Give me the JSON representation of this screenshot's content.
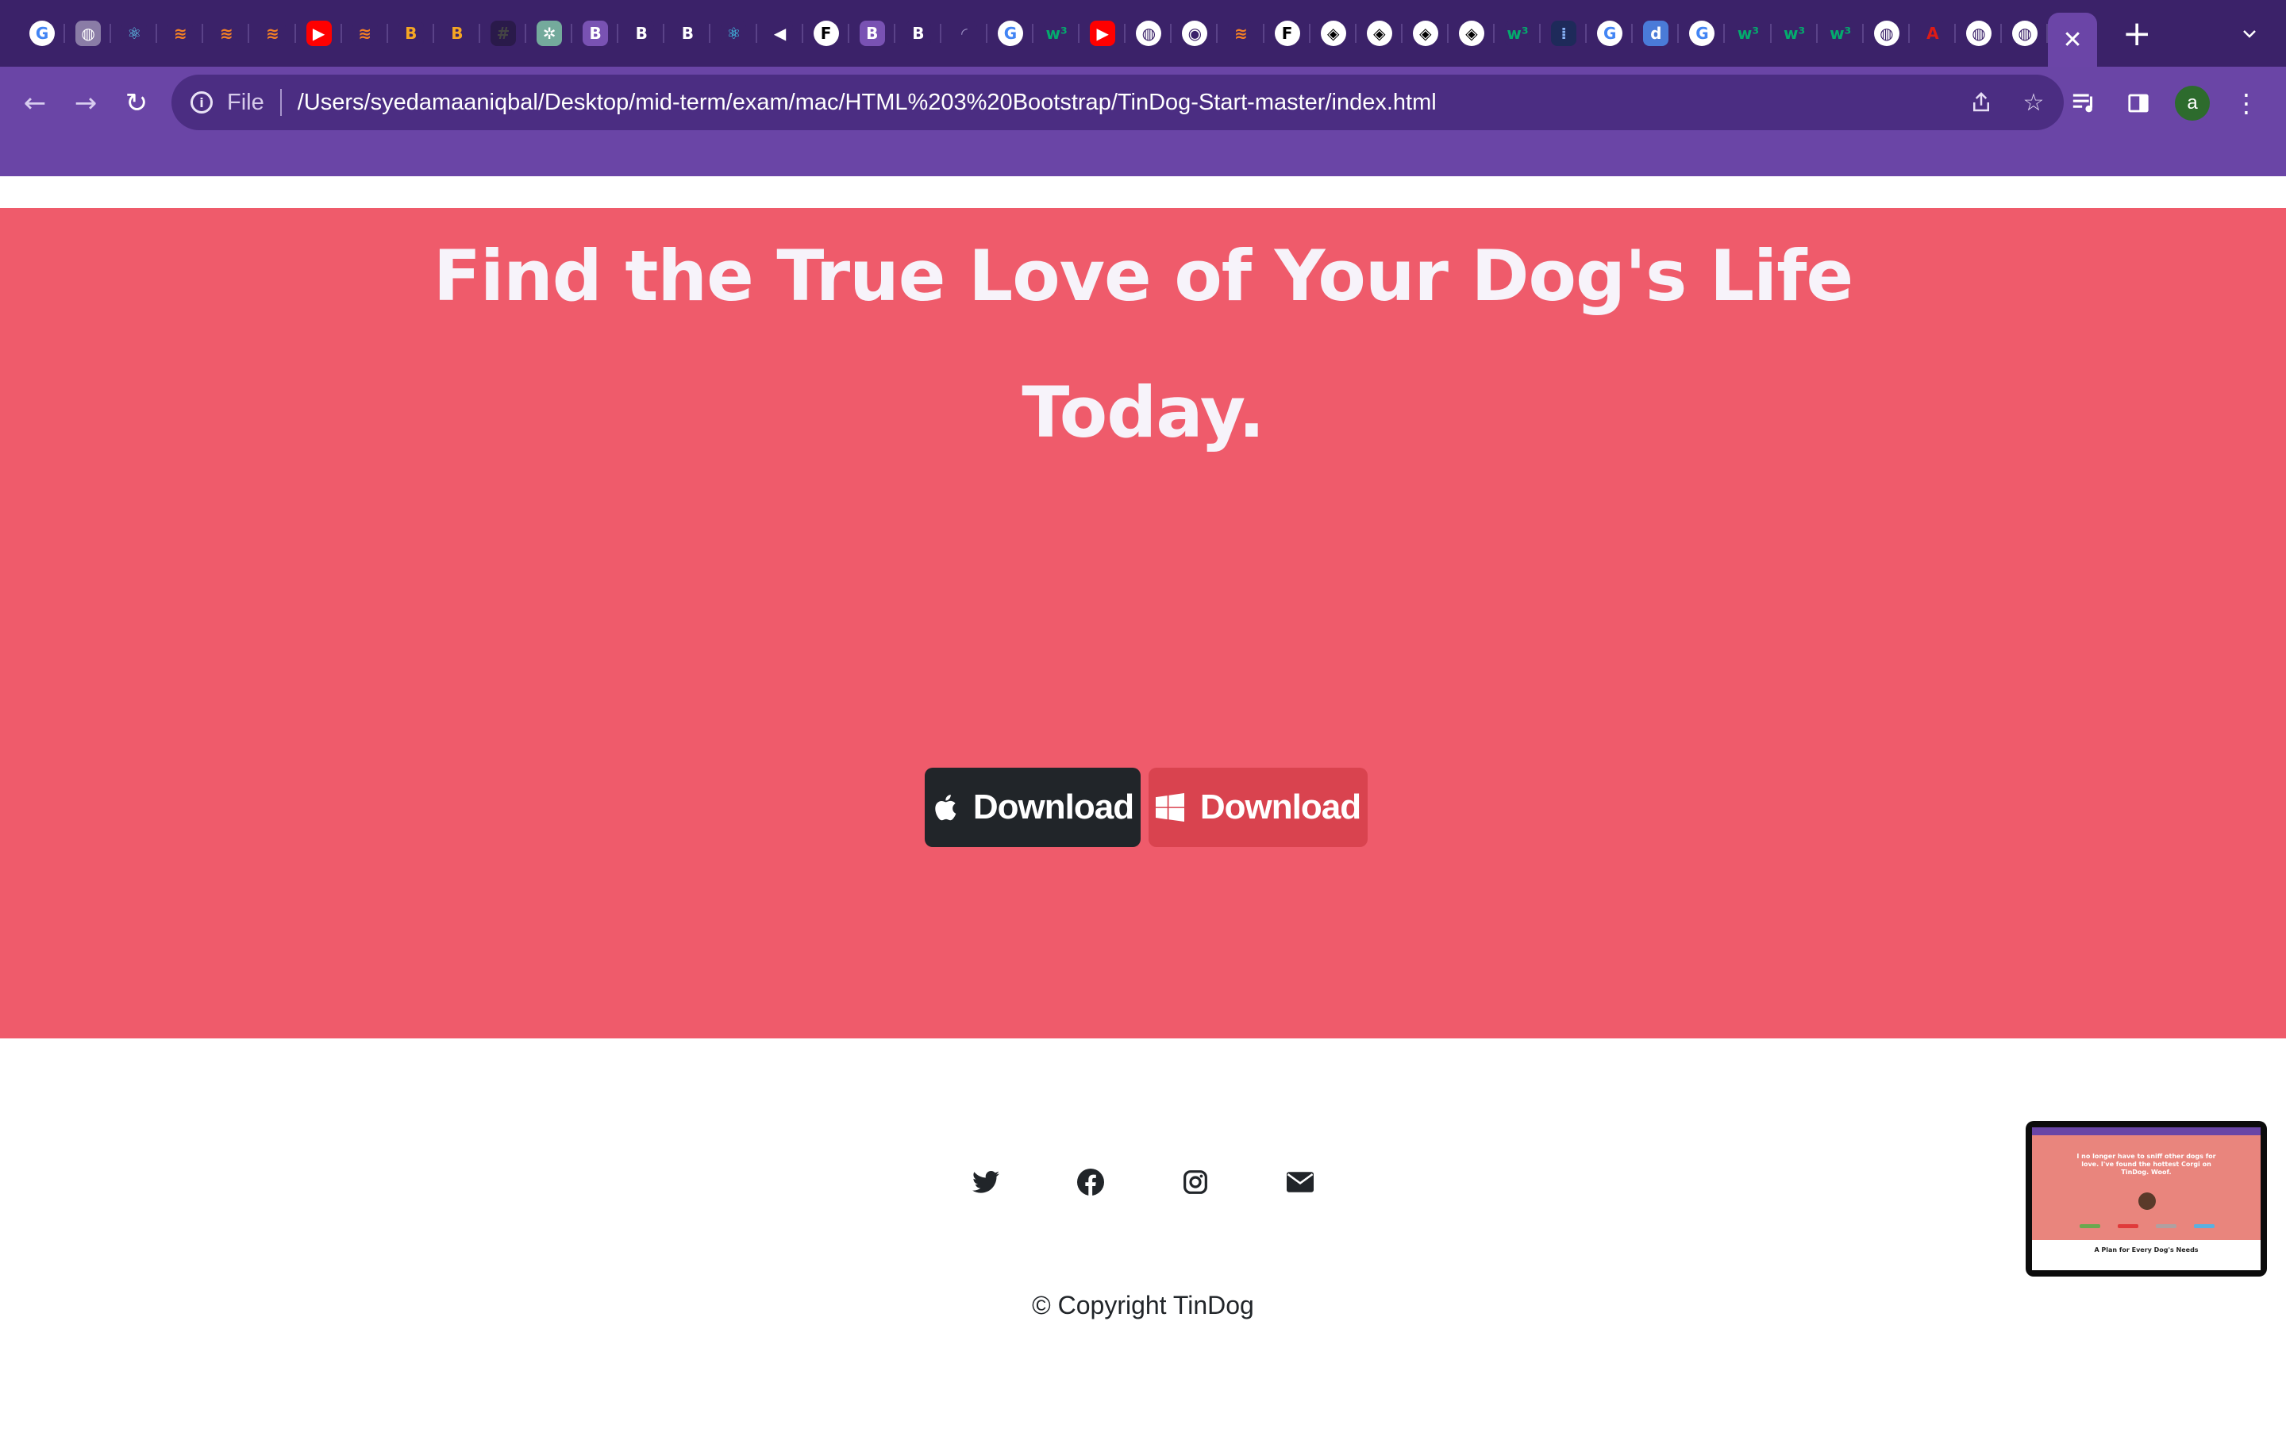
{
  "browser": {
    "tab_favicons": [
      {
        "icon": "google-g-icon",
        "glyph": "G",
        "bg": "#ffffff",
        "fg": "#4285f4"
      },
      {
        "icon": "globe-icon",
        "glyph": "◍",
        "bg": "#8a7ca6",
        "fg": "#ffffff"
      },
      {
        "icon": "react-atom-icon",
        "glyph": "⚛",
        "bg": "#3b2269",
        "fg": "#61dafb"
      },
      {
        "icon": "stackoverflow-icon",
        "glyph": "≋",
        "bg": "#3b2269",
        "fg": "#f48024"
      },
      {
        "icon": "stackoverflow-icon",
        "glyph": "≋",
        "bg": "#3b2269",
        "fg": "#f48024"
      },
      {
        "icon": "stackoverflow-icon",
        "glyph": "≋",
        "bg": "#3b2269",
        "fg": "#f48024"
      },
      {
        "icon": "youtube-icon",
        "glyph": "▶",
        "bg": "#ff0000",
        "fg": "#ffffff"
      },
      {
        "icon": "stackoverflow-icon",
        "glyph": "≋",
        "bg": "#3b2269",
        "fg": "#f48024"
      },
      {
        "icon": "b-logo-icon",
        "glyph": "B",
        "bg": "#3b2269",
        "fg": "#f5a623"
      },
      {
        "icon": "b-logo-icon",
        "glyph": "B",
        "bg": "#3b2269",
        "fg": "#f5a623"
      },
      {
        "icon": "dark-app-icon",
        "glyph": "#",
        "bg": "#2a1a4a",
        "fg": "#444444"
      },
      {
        "icon": "chatgpt-icon",
        "glyph": "✲",
        "bg": "#74aa9c",
        "fg": "#ffffff"
      },
      {
        "icon": "bootstrap-icon",
        "glyph": "B",
        "bg": "#7952b3",
        "fg": "#ffffff"
      },
      {
        "icon": "bold-b-icon",
        "glyph": "B",
        "bg": "#3b2269",
        "fg": "#ffffff"
      },
      {
        "icon": "bold-b-icon",
        "glyph": "B",
        "bg": "#3b2269",
        "fg": "#ffffff"
      },
      {
        "icon": "react-bootstrap-icon",
        "glyph": "⚛",
        "bg": "#3b2269",
        "fg": "#41e0fd"
      },
      {
        "icon": "speaker-icon",
        "glyph": "◀",
        "bg": "#3b2269",
        "fg": "#ffffff"
      },
      {
        "icon": "framer-f-icon",
        "glyph": "F",
        "bg": "#ffffff",
        "fg": "#000000"
      },
      {
        "icon": "bootstrap-icon",
        "glyph": "B",
        "bg": "#7952b3",
        "fg": "#ffffff"
      },
      {
        "icon": "bold-b-icon",
        "glyph": "B",
        "bg": "#3b2269",
        "fg": "#ffffff"
      },
      {
        "icon": "loading-spinner-icon",
        "glyph": "◜",
        "bg": "#3b2269",
        "fg": "#9b8fc4"
      },
      {
        "icon": "google-g-icon",
        "glyph": "G",
        "bg": "#ffffff",
        "fg": "#4285f4"
      },
      {
        "icon": "w3schools-icon",
        "glyph": "w³",
        "bg": "#3b2269",
        "fg": "#04aa6d"
      },
      {
        "icon": "youtube-icon",
        "glyph": "▶",
        "bg": "#ff0000",
        "fg": "#ffffff"
      },
      {
        "icon": "globe-icon",
        "glyph": "◍",
        "bg": "#ffffff",
        "fg": "#3b2269"
      },
      {
        "icon": "chrome-icon",
        "glyph": "◉",
        "bg": "#ffffff",
        "fg": "#3b2269"
      },
      {
        "icon": "stackoverflow-icon",
        "glyph": "≋",
        "bg": "#3b2269",
        "fg": "#f48024"
      },
      {
        "icon": "framer-f-icon",
        "glyph": "F",
        "bg": "#ffffff",
        "fg": "#000000"
      },
      {
        "icon": "codepen-icon",
        "glyph": "◈",
        "bg": "#ffffff",
        "fg": "#000000"
      },
      {
        "icon": "codepen-icon",
        "glyph": "◈",
        "bg": "#ffffff",
        "fg": "#000000"
      },
      {
        "icon": "codepen-icon",
        "glyph": "◈",
        "bg": "#ffffff",
        "fg": "#000000"
      },
      {
        "icon": "codepen-icon",
        "glyph": "◈",
        "bg": "#ffffff",
        "fg": "#000000"
      },
      {
        "icon": "w3schools-icon",
        "glyph": "w³",
        "bg": "#3b2269",
        "fg": "#04aa6d"
      },
      {
        "icon": "dotted-app-icon",
        "glyph": "⁞",
        "bg": "#1e2a5a",
        "fg": "#8ab4f8"
      },
      {
        "icon": "google-g-icon",
        "glyph": "G",
        "bg": "#ffffff",
        "fg": "#4285f4"
      },
      {
        "icon": "d-logo-icon",
        "glyph": "d",
        "bg": "#4a7bd8",
        "fg": "#ffffff"
      },
      {
        "icon": "google-g-icon",
        "glyph": "G",
        "bg": "#ffffff",
        "fg": "#4285f4"
      },
      {
        "icon": "w3schools-icon",
        "glyph": "w³",
        "bg": "#3b2269",
        "fg": "#04aa6d"
      },
      {
        "icon": "w3schools-icon",
        "glyph": "w³",
        "bg": "#3b2269",
        "fg": "#04aa6d"
      },
      {
        "icon": "w3schools-icon",
        "glyph": "w³",
        "bg": "#3b2269",
        "fg": "#04aa6d"
      },
      {
        "icon": "globe-icon",
        "glyph": "◍",
        "bg": "#ffffff",
        "fg": "#3b2269"
      },
      {
        "icon": "angular-icon",
        "glyph": "A",
        "bg": "#3b2269",
        "fg": "#dd1b16"
      },
      {
        "icon": "globe-icon",
        "glyph": "◍",
        "bg": "#ffffff",
        "fg": "#3b2269"
      },
      {
        "icon": "globe-icon",
        "glyph": "◍",
        "bg": "#ffffff",
        "fg": "#3b2269"
      }
    ],
    "active_tab_close": "✕",
    "new_tab": "+",
    "tab_search": "⌄",
    "nav": {
      "back": "←",
      "forward": "→",
      "reload": "↻"
    },
    "omnibox": {
      "scheme": "File",
      "url": "/Users/syedamaaniqbal/Desktop/mid-term/exam/mac/HTML%203%20Bootstrap/TinDog-Start-master/index.html"
    },
    "profile_initial": "a",
    "colors": {
      "tabstrip": "#3b2269",
      "toolbar": "#6a45a6",
      "omnibox": "#4b2d82"
    }
  },
  "cta": {
    "heading": "Find the True Love of Your Dog's Life Today.",
    "buttons": [
      {
        "label": "Download",
        "icon": "apple-icon",
        "style": "dark"
      },
      {
        "label": "Download",
        "icon": "windows-icon",
        "style": "light"
      }
    ],
    "background": "#ef5b6b"
  },
  "footer": {
    "social_icons": [
      "twitter-icon",
      "facebook-icon",
      "instagram-icon",
      "envelope-icon"
    ],
    "copyright": "© Copyright TinDog"
  },
  "pip_preview": {
    "hero_text": "I no longer have to sniff other dogs for love. I've found the hottest Corgi on TinDog. Woof.",
    "caption": "A Plan for Every Dog's Needs"
  }
}
